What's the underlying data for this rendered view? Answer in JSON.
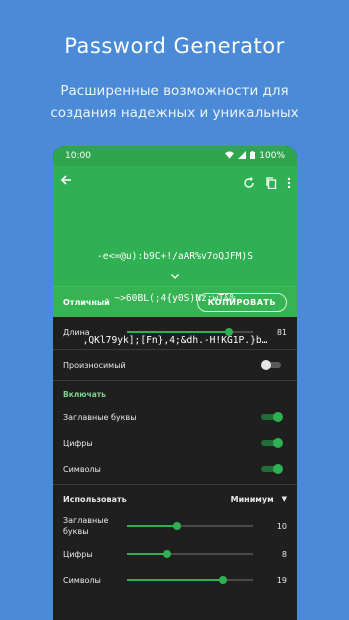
{
  "promo": {
    "title": "Password Generator",
    "subtitle_line1": "Расширенные возможности для",
    "subtitle_line2": "создания надежных и уникальных"
  },
  "status_bar": {
    "time": "10:00",
    "battery": "100%"
  },
  "generated": {
    "line1": "-e<=@u):b9C+!/aAR%v7oQJFM)S",
    "line2": "~>60BL(;4{y0S)Nz:wT&%",
    "line3": ",QKl79yk];[Fn},4;&dh.-H!KG1P.}b…"
  },
  "strength": {
    "label": "Отличный",
    "copy_label": "КОПИРОВАТЬ"
  },
  "settings": {
    "length_label": "Длина",
    "length_value": "81",
    "length_fraction": 0.81,
    "pronounceable_label": "Произносимый",
    "include_header": "Включать",
    "uppercase_label": "Заглавные буквы",
    "digits_label": "Цифры",
    "symbols_label": "Символы",
    "use_label": "Использовать",
    "use_value": "Минимум",
    "min_upper_label": "Заглавные буквы",
    "min_upper_value": "10",
    "min_upper_fraction": 0.4,
    "min_digits_label": "Цифры",
    "min_digits_value": "8",
    "min_digits_fraction": 0.32,
    "min_symbols_label": "Символы",
    "min_symbols_value": "19",
    "min_symbols_fraction": 0.76
  },
  "colors": {
    "background": "#4a8ad6",
    "accent": "#2fb052",
    "panel": "#1f1f1f"
  },
  "icons": [
    "back-arrow-icon",
    "refresh-icon",
    "copy-icon",
    "more-vert-icon",
    "chevron-down-icon",
    "wifi-icon",
    "signal-icon",
    "battery-icon"
  ]
}
